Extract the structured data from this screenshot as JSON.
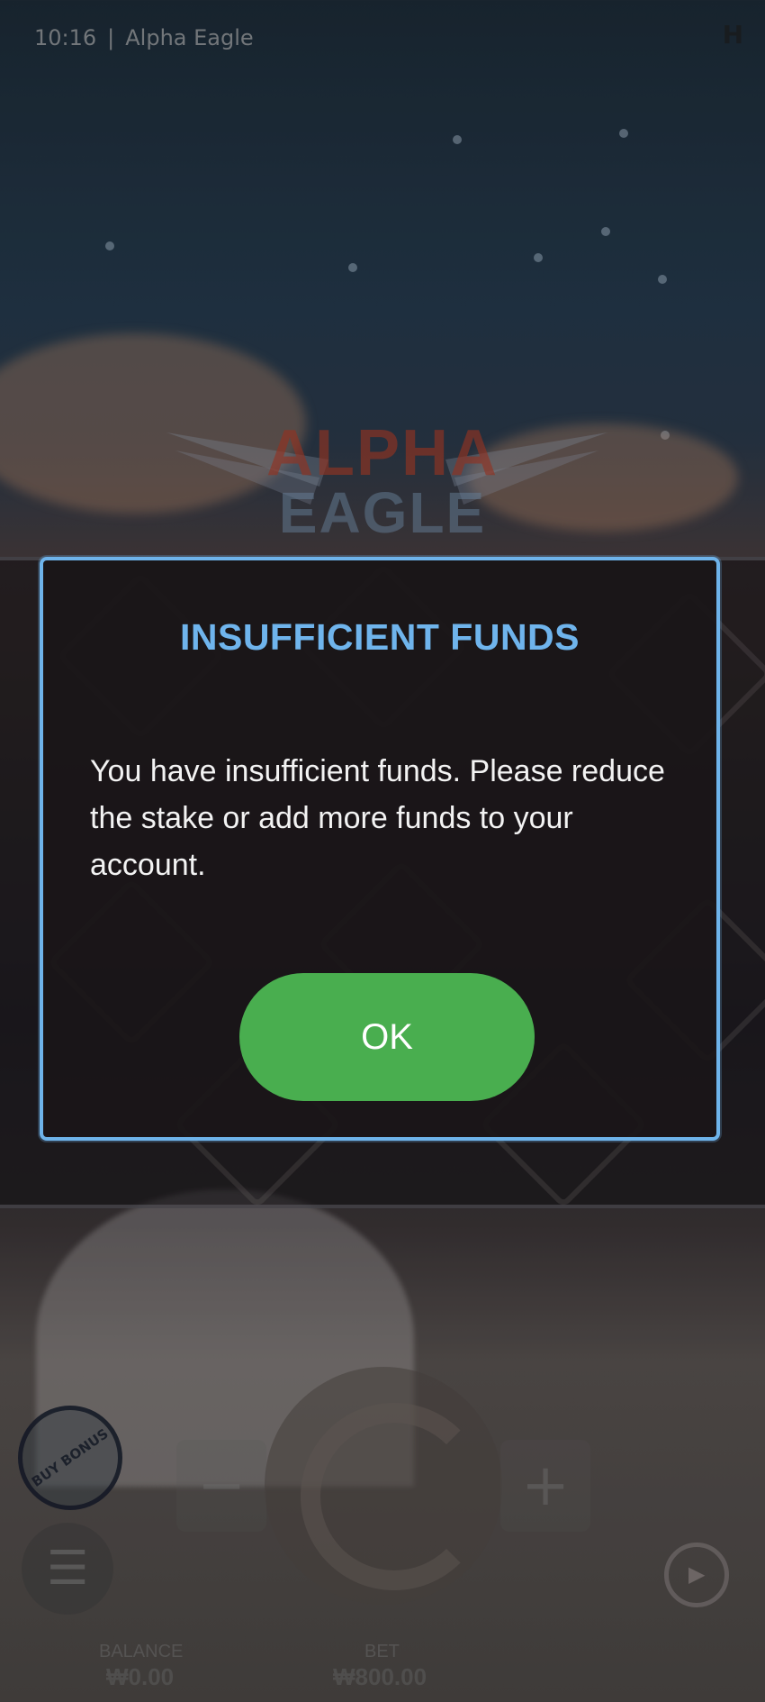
{
  "status_bar": {
    "time": "10:16",
    "separator": "|",
    "game_title": "Alpha Eagle",
    "corner_icon": "H"
  },
  "logo": {
    "line1": "ALPHA",
    "line2": "EAGLE"
  },
  "controls": {
    "buy_bonus_label": "BUY BONUS",
    "menu_icon": "☰",
    "minus_label": "−",
    "plus_label": "+",
    "autoplay_icon": "▶",
    "balance_label": "BALANCE",
    "balance_value": "₩0.00",
    "bet_label": "BET",
    "bet_value": "₩800.00"
  },
  "dialog": {
    "title": "INSUFFICIENT FUNDS",
    "message": "You have insufficient funds. Please reduce the stake or add more funds to your account.",
    "ok_label": "OK"
  },
  "colors": {
    "dialog_border": "#6eb3ea",
    "dialog_title": "#6fb4ec",
    "ok_button": "#49ae4f"
  }
}
